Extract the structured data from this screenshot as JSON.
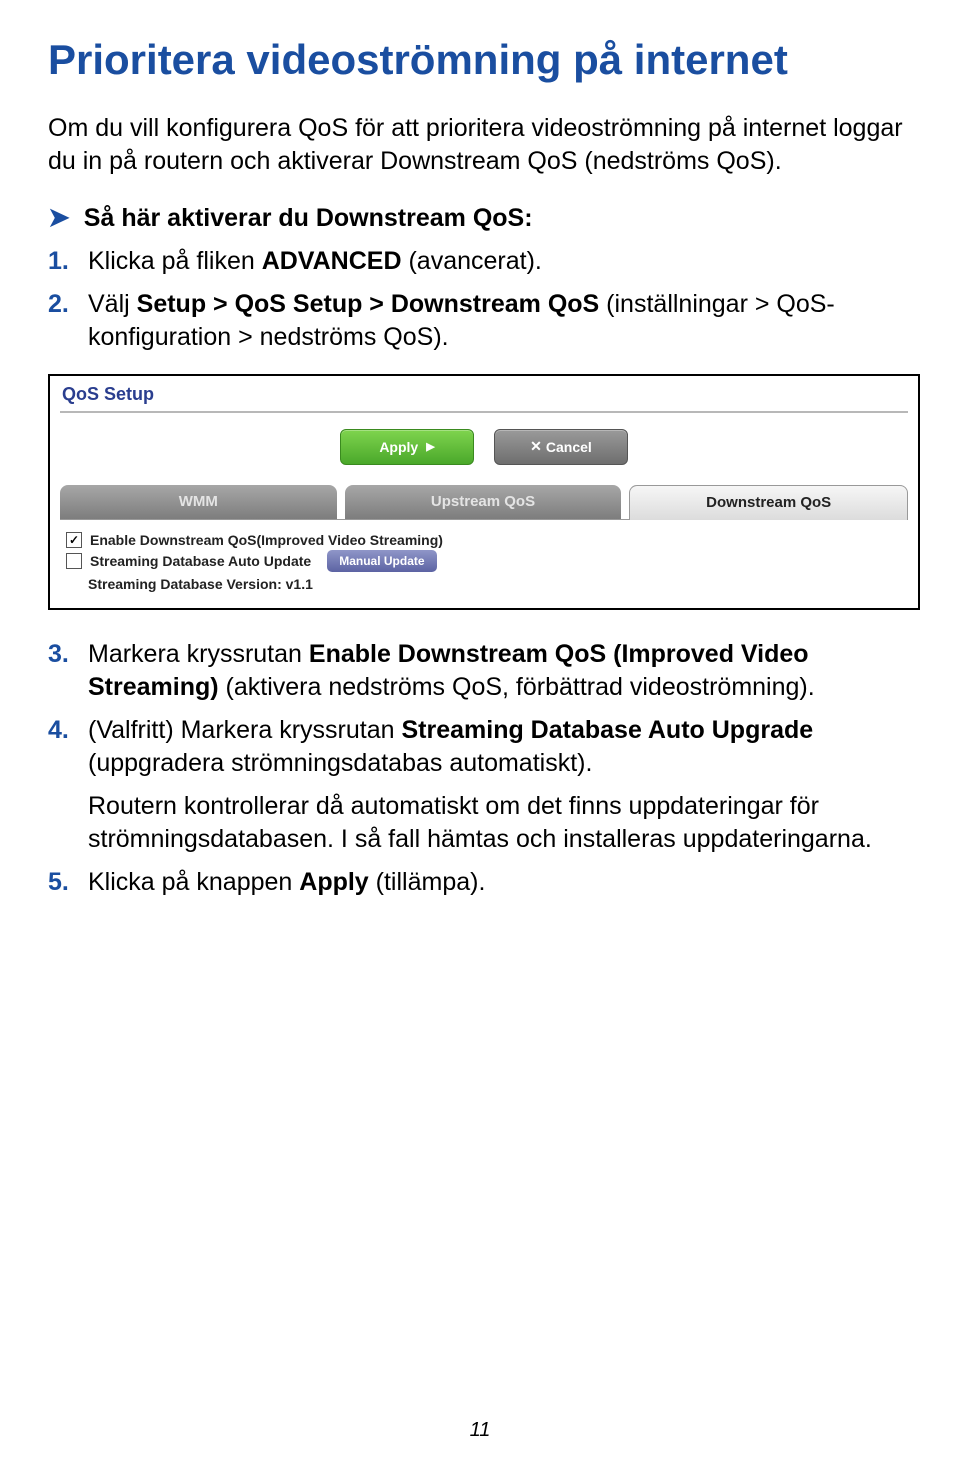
{
  "title": "Prioritera videoströmning på internet",
  "intro": "Om du vill konfigurera QoS för att prioritera videoströmning på internet loggar du in på routern och aktiverar Downstream QoS (nedströms QoS).",
  "bullet": "Så här aktiverar du Downstream QoS:",
  "steps": {
    "s1_pre": "Klicka på fliken ",
    "s1_b": "ADVANCED",
    "s1_post": " (avancerat).",
    "s2_pre": "Välj ",
    "s2_b": "Setup > QoS Setup > Downstream QoS",
    "s2_post": " (inställningar > QoS-konfiguration > nedströms QoS).",
    "s3_pre": "Markera kryssrutan ",
    "s3_b": "Enable Downstream QoS (Improved Video Streaming)",
    "s3_post": " (aktivera nedströms QoS, förbättrad videoströmning).",
    "s4_pre": "(Valfritt) Markera kryssrutan ",
    "s4_b": "Streaming Database Auto Upgrade",
    "s4_post": " (uppgradera strömningsdatabas automatiskt).",
    "s4_tail": "Routern kontrollerar då automatiskt om det finns uppdateringar för strömningsdatabasen. I så fall hämtas och installeras uppdateringarna.",
    "s5_pre": "Klicka på knappen ",
    "s5_b": "Apply",
    "s5_post": " (tillämpa)."
  },
  "panel": {
    "title": "QoS Setup",
    "apply": "Apply",
    "cancel": "Cancel",
    "tab_wmm": "WMM",
    "tab_up": "Upstream QoS",
    "tab_down": "Downstream QoS",
    "chk1": "Enable Downstream QoS(Improved Video Streaming)",
    "chk2": "Streaming Database Auto Update",
    "manual": "Manual Update",
    "version_label": "Streaming Database Version:",
    "version_value": "v1.1"
  },
  "page_number": "11"
}
